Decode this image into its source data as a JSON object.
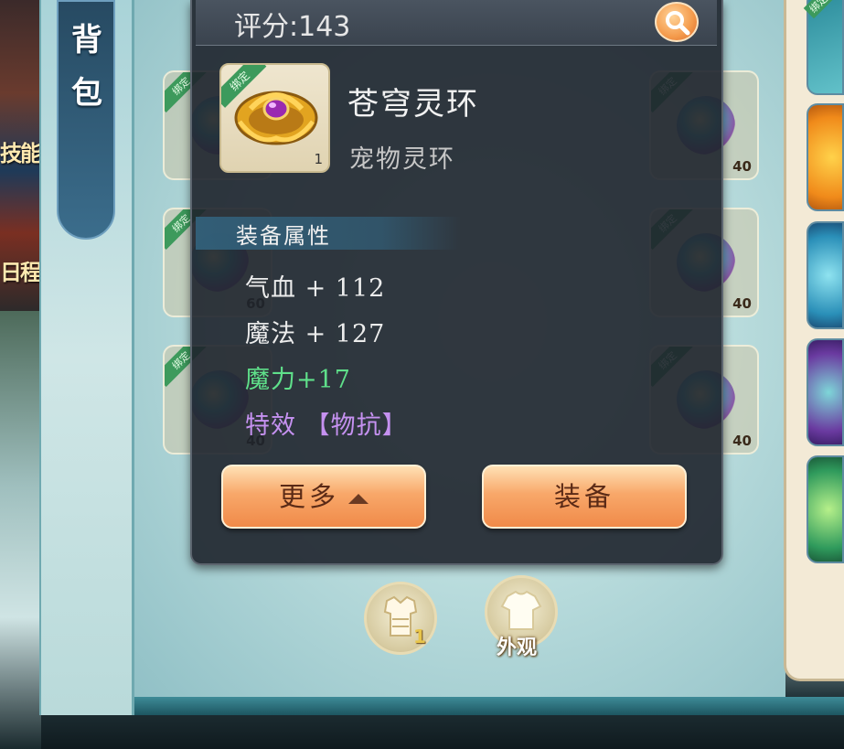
{
  "left_strip": {
    "labels": [
      "技能",
      "日程"
    ]
  },
  "sidebar": {
    "bag_tab_chars": [
      "背",
      "包"
    ]
  },
  "tooltip": {
    "score_label": "评分:143",
    "item": {
      "name": "苍穹灵环",
      "type": "宠物灵环",
      "count": "1",
      "bind_tag": "绑定"
    },
    "section_title": "装备属性",
    "attributes": {
      "hp": "气血 + 112",
      "mp": "魔法 + 127",
      "magic_power": "魔力+17",
      "effect": "特效 【物抗】"
    },
    "buttons": {
      "more": "更多",
      "equip": "装备"
    }
  },
  "slots": {
    "left": [
      {
        "level": "",
        "bind": "绑定"
      },
      {
        "level": "60",
        "bind": "绑定"
      },
      {
        "level": "40",
        "bind": "绑定"
      }
    ],
    "right": [
      {
        "level": "40",
        "bind": "绑定"
      },
      {
        "level": "40",
        "bind": "绑定"
      },
      {
        "level": "40",
        "bind": "绑定"
      }
    ],
    "right_panel_top_bind": "绑定"
  },
  "bottom_buttons": {
    "armor_count": "1",
    "appearance_label": "外观"
  },
  "colors": {
    "tooltip_bg": "#1e242c",
    "attr_green": "#5fe08a",
    "attr_purple": "#c591f0",
    "button_orange": "#f8a86a",
    "bind_green": "#3d9a5c"
  },
  "icons": [
    "search-icon",
    "ring-icon",
    "armor-icon",
    "shirt-icon",
    "chevron-up-icon"
  ]
}
